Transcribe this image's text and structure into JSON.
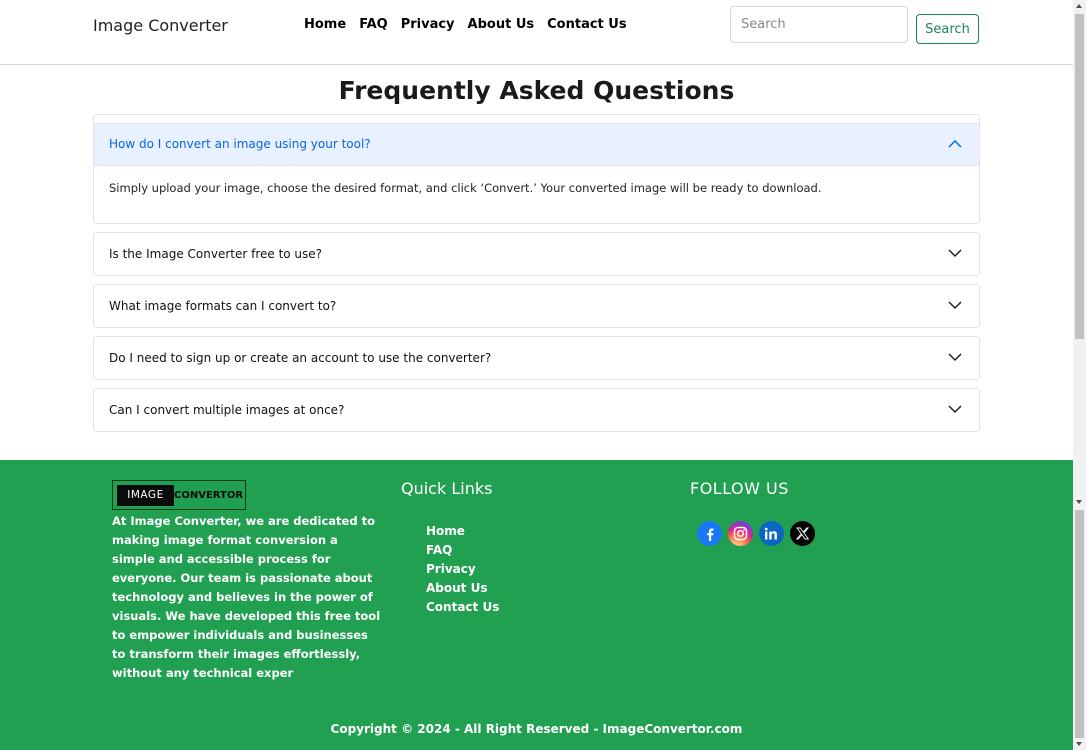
{
  "navbar": {
    "brand": "Image Converter",
    "links": [
      "Home",
      "FAQ",
      "Privacy",
      "About Us",
      "Contact Us"
    ],
    "search_placeholder": "Search",
    "search_button": "Search"
  },
  "faq": {
    "title": "Frequently Asked Questions",
    "open_item": {
      "question": "How do I convert an image using your tool?",
      "answer": "Simply upload your image, choose the desired format, and click ‘Convert.’ Your converted image will be ready to download."
    },
    "items": [
      "Is the Image Converter free to use?",
      "What image formats can I convert to?",
      "Do I need to sign up or create an account to use the converter?",
      "Can I convert multiple images at once?"
    ]
  },
  "footer": {
    "logo_part1": "IMAGE",
    "logo_part2": "CONVERTOR",
    "about": "At Image Converter, we are dedicated to making image format conversion a simple and accessible process for everyone. Our team is passionate about technology and believes in the power of visuals. We have developed this free tool to empower individuals and businesses to transform their images effortlessly, without any technical exper",
    "quick_links_title": "Quick Links",
    "quick_links": [
      "Home",
      "FAQ",
      "Privacy",
      "About Us",
      "Contact Us"
    ],
    "follow_title": "FOLLOW US",
    "social_icons": [
      "facebook-icon",
      "instagram-icon",
      "linkedin-icon",
      "x-icon"
    ],
    "copyright": "Copyright © 2024 - All Right Reserved - ImageConvertor.com"
  },
  "colors": {
    "footer_bg": "#22a052",
    "accent_green": "#198754",
    "accordion_active_bg": "#e7f1ff",
    "accordion_active_text": "#0c63e4"
  }
}
